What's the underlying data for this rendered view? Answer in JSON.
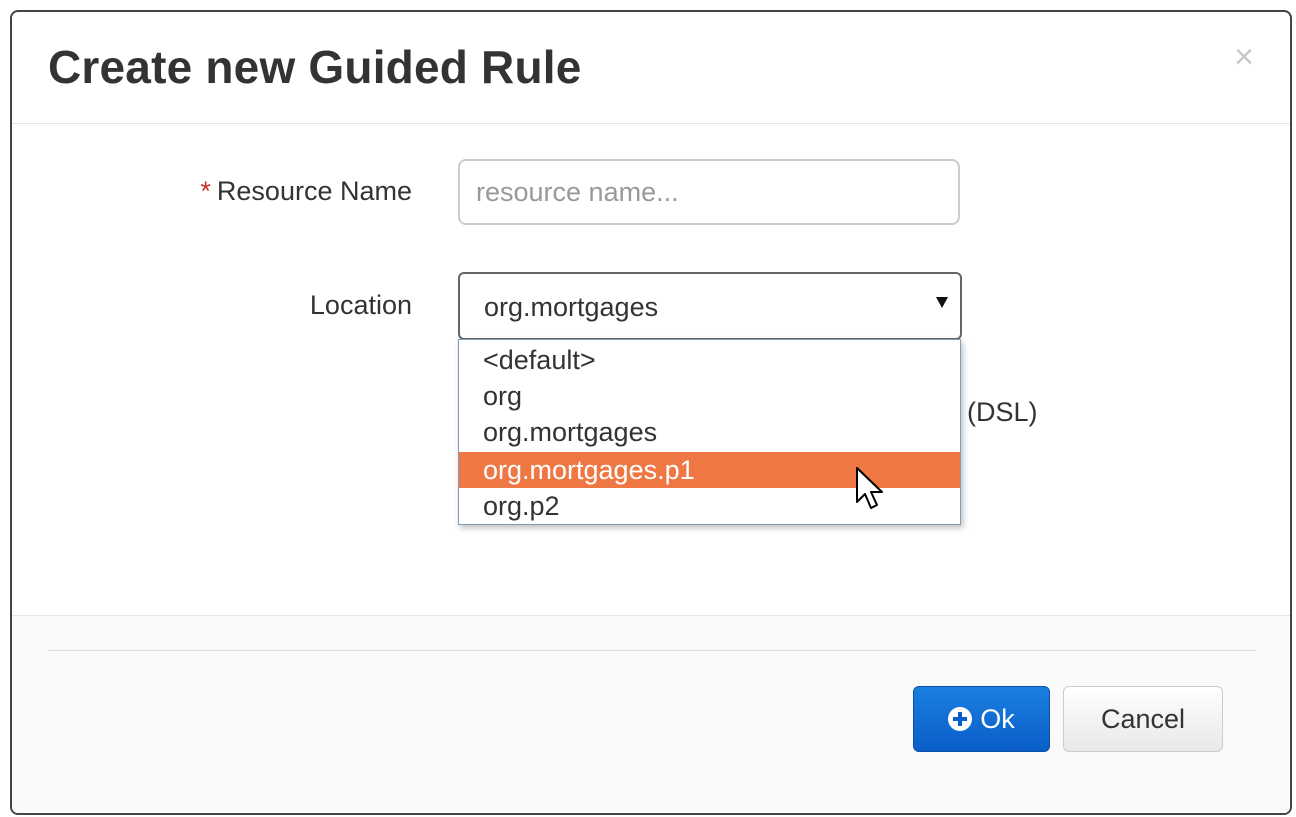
{
  "dialog": {
    "title": "Create new Guided Rule",
    "close_symbol": "×"
  },
  "form": {
    "resource_name": {
      "required_marker": "*",
      "label": "Resource Name",
      "placeholder": "resource name...",
      "value": ""
    },
    "location": {
      "label": "Location",
      "selected": "org.mortgages",
      "options": [
        "<default>",
        "org",
        "org.mortgages",
        "org.mortgages.p1",
        "org.p2"
      ],
      "highlighted_option": "org.mortgages.p1"
    },
    "dsl_partial_text": "(DSL)"
  },
  "footer": {
    "ok_label": "Ok",
    "ok_icon": "plus-circle-icon",
    "cancel_label": "Cancel"
  },
  "colors": {
    "primary": "#0a5ec8",
    "highlight": "#ee7744",
    "required": "#c9302c"
  }
}
